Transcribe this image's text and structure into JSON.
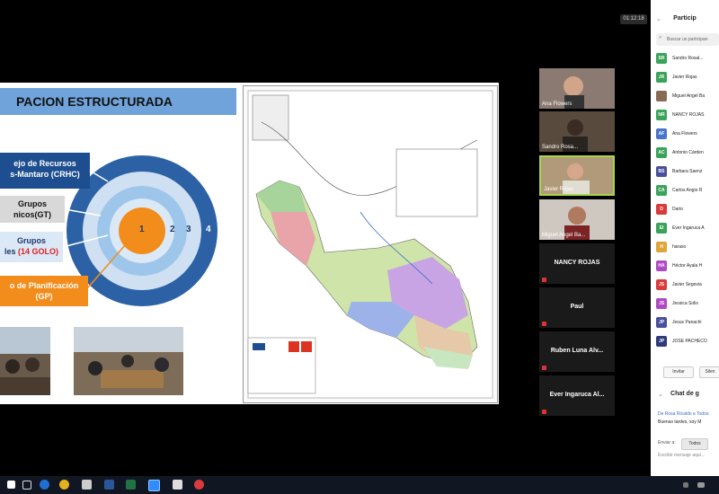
{
  "meeting": {
    "timer": "01:12:18"
  },
  "slide": {
    "title": "PACION ESTRUCTURADA",
    "crhc_label_1": "ejo de Recursos",
    "crhc_label_2": "s-Mantaro (CRHC)",
    "gt_label_1": "Grupos",
    "gt_label_2": "nicos(GT)",
    "gl_label_1": "Grupos",
    "gl_label_2": "les",
    "gl_label_red": "(14 GOLO)",
    "gp_label_1": "o de Planificación",
    "gp_label_2": "(GP)",
    "rings": [
      "1",
      "2",
      "3",
      "4"
    ],
    "colors": {
      "title_bar": "#6fa3da",
      "ring_outer": "#2c62a5",
      "ring_mid": "#cfe0f3",
      "ring_inner": "#9ec6ea",
      "core": "#f28c1a"
    }
  },
  "videos": [
    {
      "name": "Ana Flowers",
      "kind": "camera"
    },
    {
      "name": "Sandro Rosa...",
      "kind": "camera"
    },
    {
      "name": "Javier Rojas",
      "kind": "camera"
    },
    {
      "name": "Miguel Angel Ba...",
      "kind": "camera"
    },
    {
      "name": "NANCY ROJAS",
      "kind": "name"
    },
    {
      "name": "Paul",
      "kind": "name"
    },
    {
      "name": "Ruben Luna Alv...",
      "kind": "name"
    },
    {
      "name": "Ever Ingaruca Al...",
      "kind": "name"
    }
  ],
  "panel": {
    "title": "Particip",
    "search_placeholder": "Buscar un participan",
    "participants": [
      {
        "initials": "SR",
        "name": "Sandro Rosal...",
        "color": "#3aa35a"
      },
      {
        "initials": "JR",
        "name": "Javier Rojas",
        "color": "#3aa35a"
      },
      {
        "initials": "",
        "name": "Miguel Angel Ba",
        "color": "#8a6a55"
      },
      {
        "initials": "NR",
        "name": "NANCY ROJAS",
        "color": "#3aa35a"
      },
      {
        "initials": "AF",
        "name": "Ana Flowers",
        "color": "#4a74c9"
      },
      {
        "initials": "AC",
        "name": "Antonio Cárden",
        "color": "#3aa35a"
      },
      {
        "initials": "BS",
        "name": "Barbara Saenz",
        "color": "#4a4f9c"
      },
      {
        "initials": "CA",
        "name": "Carlos Angio R",
        "color": "#3aa35a"
      },
      {
        "initials": "D",
        "name": "Dario",
        "color": "#d93b3b"
      },
      {
        "initials": "EI",
        "name": "Ever Ingaruca A",
        "color": "#3aa35a"
      },
      {
        "initials": "H",
        "name": "haraso",
        "color": "#e0a53a"
      },
      {
        "initials": "HA",
        "name": "Héctor Ayala H",
        "color": "#b04ac2"
      },
      {
        "initials": "JS",
        "name": "Javier Segovia",
        "color": "#d93b3b"
      },
      {
        "initials": "JS",
        "name": "Jessica Solis",
        "color": "#b04ac2"
      },
      {
        "initials": "JP",
        "name": "Jesus Panachi",
        "color": "#4a4f9c"
      },
      {
        "initials": "JP",
        "name": "JOSE PACHECO",
        "color": "#2f3a7a"
      }
    ],
    "invite_label": "Invitar",
    "mute_label": "Silen",
    "chat_title": "Chat de g",
    "chat_sender": "De Rosa Ricaldo a Todos:",
    "chat_message": "Buenas tardes, soy M",
    "send_to_label": "Enviar a:",
    "send_to_value": "Todos",
    "message_placeholder": "Escribir mensaje aquí..."
  }
}
